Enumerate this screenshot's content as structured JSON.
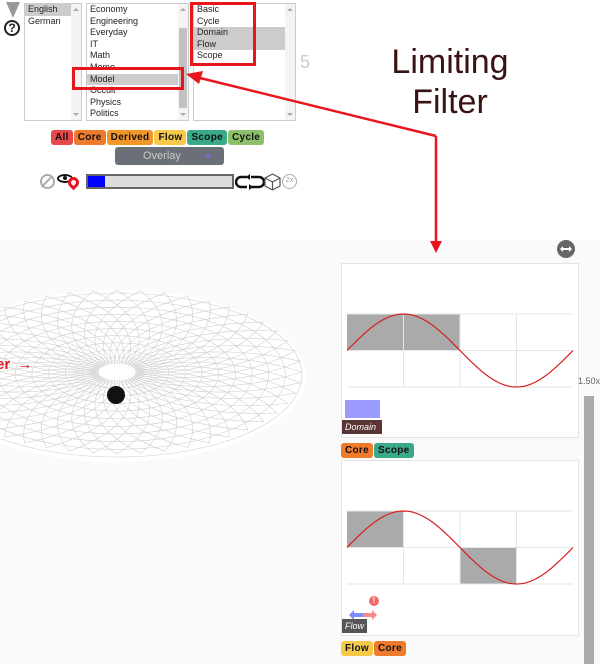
{
  "controls": {
    "collapse_icon": "triangle-down-icon",
    "help_icon": "question-circle-icon",
    "help_glyph": "?"
  },
  "languages": {
    "items": [
      {
        "label": "English",
        "selected": true
      },
      {
        "label": "German",
        "selected": false
      }
    ]
  },
  "categories": {
    "items": [
      {
        "label": "Economy",
        "selected": false
      },
      {
        "label": "Engineering",
        "selected": false
      },
      {
        "label": "Everyday",
        "selected": false
      },
      {
        "label": "IT",
        "selected": false
      },
      {
        "label": "Math",
        "selected": false
      },
      {
        "label": "Memo",
        "selected": false
      },
      {
        "label": "Model",
        "selected": true
      },
      {
        "label": "Occult",
        "selected": false
      },
      {
        "label": "Physics",
        "selected": false
      },
      {
        "label": "Politics",
        "selected": false
      }
    ]
  },
  "types": {
    "items": [
      {
        "label": "Basic",
        "selected": false
      },
      {
        "label": "Cycle",
        "selected": false
      },
      {
        "label": "Domain",
        "selected": true
      },
      {
        "label": "Flow",
        "selected": true
      },
      {
        "label": "Scope",
        "selected": false
      }
    ]
  },
  "count_label": "5",
  "filter_tags": [
    {
      "label": "All",
      "color": "#e8484a"
    },
    {
      "label": "Core",
      "color": "#f07a2c"
    },
    {
      "label": "Derived",
      "color": "#f3962a"
    },
    {
      "label": "Flow",
      "color": "#f7c94b"
    },
    {
      "label": "Scope",
      "color": "#3aa98a"
    },
    {
      "label": "Cycle",
      "color": "#8cc16a"
    }
  ],
  "overlay": {
    "label": "Overlay",
    "plus": "+"
  },
  "playback": {
    "progress_fraction": 0.12,
    "speed_badge": "2x",
    "icons": [
      "disabled-icon",
      "eye-icon",
      "map-pin-icon",
      "loop-icon",
      "cube-icon",
      "speed-2x-icon"
    ]
  },
  "annotation": {
    "title_line1": "Limiting",
    "title_line2": "Filter"
  },
  "viewport": {
    "label_fragment": "er",
    "label_arrow": "→",
    "expand_icon": "double-arrow-icon",
    "zoom_label": "1.50x"
  },
  "cards": [
    {
      "caption": "Domain",
      "tags": [
        {
          "label": "Core",
          "color": "#f07a2c"
        },
        {
          "label": "Scope",
          "color": "#3aa98a"
        }
      ]
    },
    {
      "caption": "Flow",
      "warning": "!",
      "tags": [
        {
          "label": "Flow",
          "color": "#f7c94b"
        },
        {
          "label": "Core",
          "color": "#f07a2c"
        }
      ]
    }
  ]
}
